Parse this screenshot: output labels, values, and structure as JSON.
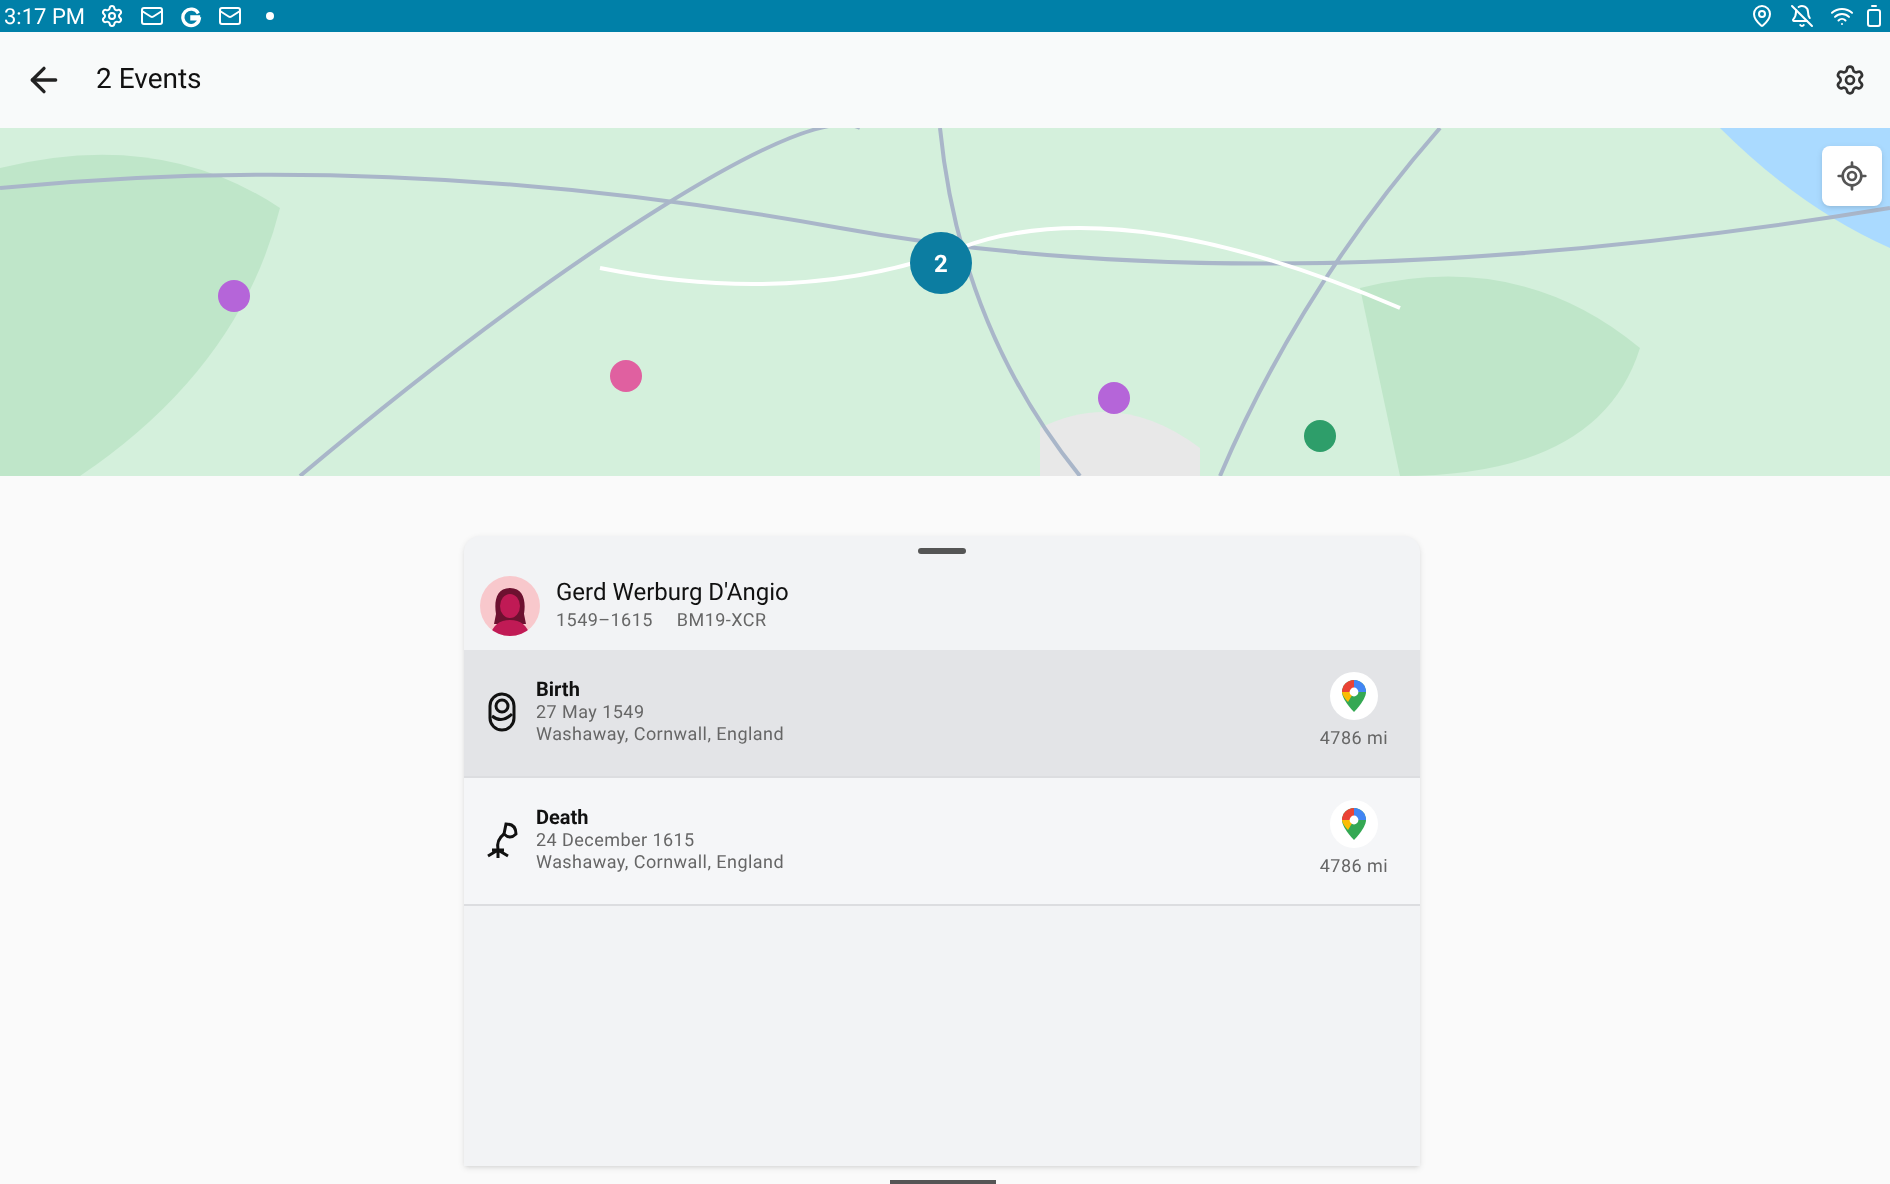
{
  "status_bar": {
    "time": "3:17 PM"
  },
  "app_bar": {
    "title": "2 Events"
  },
  "map": {
    "kind": "picture",
    "cluster": {
      "count": "2"
    }
  },
  "person": {
    "name": "Gerd Werburg D'Angio",
    "lifespan": "1549–1615",
    "id": "BM19-XCR"
  },
  "events": [
    {
      "kind": "birth",
      "title": "Birth",
      "date": "27 May 1549",
      "place": "Washaway, Cornwall, England",
      "distance": "4786 mi",
      "selected": true
    },
    {
      "kind": "death",
      "title": "Death",
      "date": "24 December 1615",
      "place": "Washaway, Cornwall, England",
      "distance": "4786 mi",
      "selected": false
    }
  ]
}
